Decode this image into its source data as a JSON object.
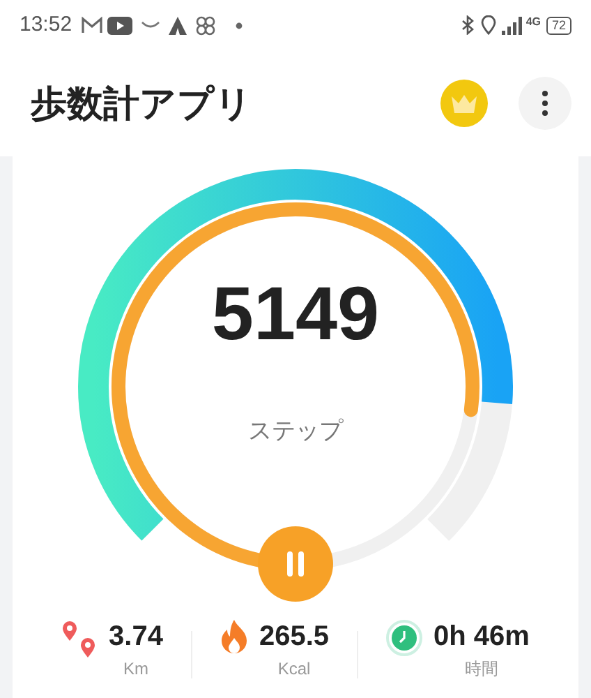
{
  "status_bar": {
    "time": "13:52",
    "network": "4G",
    "battery": "72"
  },
  "header": {
    "title": "歩数計アプリ"
  },
  "gauge": {
    "steps": "5149",
    "unit": "ステップ",
    "paused": false
  },
  "stats": [
    {
      "kind": "distance",
      "value": "3.74",
      "label": "Km"
    },
    {
      "kind": "calories",
      "value": "265.5",
      "label": "Kcal"
    },
    {
      "kind": "time",
      "value": "0h 46m",
      "label": "時間"
    }
  ]
}
